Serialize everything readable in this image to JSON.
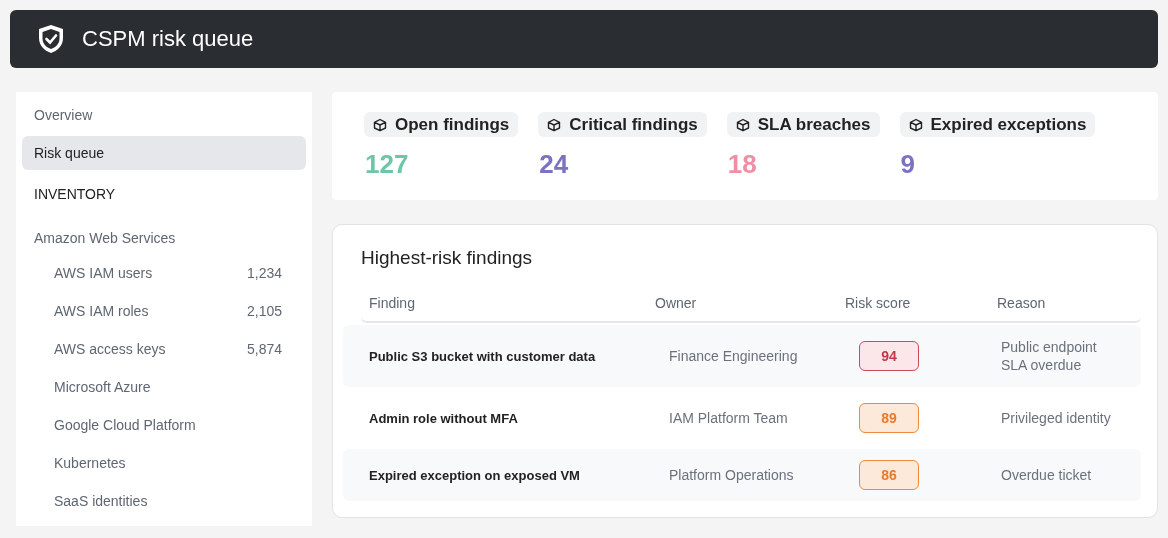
{
  "header": {
    "title": "CSPM risk queue"
  },
  "sidebar": {
    "nav": [
      {
        "label": "Overview",
        "selected": false
      },
      {
        "label": "Risk queue",
        "selected": true
      }
    ],
    "section": "INVENTORY",
    "groups": [
      {
        "label": "Amazon Web Services",
        "children": [
          {
            "label": "AWS IAM users",
            "count": "1,234"
          },
          {
            "label": "AWS IAM roles",
            "count": "2,105"
          },
          {
            "label": "AWS access keys",
            "count": "5,874"
          },
          {
            "label": "Microsoft Azure"
          },
          {
            "label": "Google Cloud Platform"
          },
          {
            "label": "Kubernetes"
          },
          {
            "label": "SaaS identities"
          }
        ]
      }
    ]
  },
  "stats": [
    {
      "label": "Open findings",
      "value": "127",
      "color": "#6cc7a8"
    },
    {
      "label": "Critical findings",
      "value": "24",
      "color": "#7b72c4"
    },
    {
      "label": "SLA breaches",
      "value": "18",
      "color": "#ee8fa4"
    },
    {
      "label": "Expired exceptions",
      "value": "9",
      "color": "#7b72c4"
    }
  ],
  "table": {
    "title": "Highest-risk findings",
    "columns": [
      "Finding",
      "Owner",
      "Risk score",
      "Reason"
    ],
    "rows": [
      {
        "finding": "Public S3 bucket with customer data",
        "owner": "Finance Engineering",
        "score": "94",
        "kind": "critical",
        "reason": "Public endpoint SLA overdue"
      },
      {
        "finding": "Admin role without MFA",
        "owner": "IAM Platform Team",
        "score": "89",
        "kind": "high",
        "reason": "Privileged identity"
      },
      {
        "finding": "Expired exception on exposed VM",
        "owner": "Platform Operations",
        "score": "86",
        "kind": "high",
        "reason": "Overdue ticket"
      }
    ]
  }
}
